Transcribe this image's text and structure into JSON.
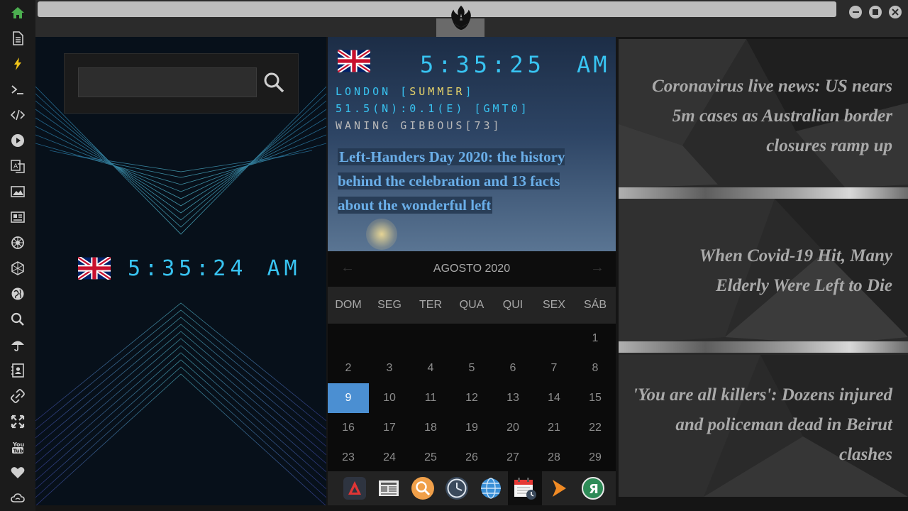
{
  "sidebar": {
    "items": [
      {
        "icon": "home-icon",
        "color": "#4caf50"
      },
      {
        "icon": "document-icon"
      },
      {
        "icon": "lightning-icon",
        "color": "#f0c419"
      },
      {
        "icon": "terminal-icon"
      },
      {
        "icon": "code-icon"
      },
      {
        "icon": "play-icon"
      },
      {
        "icon": "translate-icon"
      },
      {
        "icon": "image-icon"
      },
      {
        "icon": "news-icon"
      },
      {
        "icon": "jedi-order-icon"
      },
      {
        "icon": "galactic-empire-icon"
      },
      {
        "icon": "globe-icon"
      },
      {
        "icon": "search-icon"
      },
      {
        "icon": "umbrella-icon"
      },
      {
        "icon": "contacts-icon"
      },
      {
        "icon": "link-icon"
      },
      {
        "icon": "expand-icon"
      },
      {
        "icon": "youtube-icon"
      },
      {
        "icon": "heart-icon"
      },
      {
        "icon": "cloud-icon"
      }
    ]
  },
  "left_clock": {
    "time": "5:35:24",
    "ampm": "AM"
  },
  "search": {
    "value": "",
    "placeholder": ""
  },
  "world_clock": {
    "time": "5:35:25",
    "ampm": "AM",
    "city_prefix": "LONDON [",
    "city_season": "SUMMER",
    "city_suffix": "]",
    "coords": "51.5(N):0.1(E) [GMT0]",
    "moon": "WANING GIBBOUS[73]"
  },
  "feature_headline": "Left-Handers Day 2020: the history behind the celebration and 13 facts about the wonderful left",
  "calendar": {
    "month_label": "AGOSTO 2020",
    "prev": "←",
    "next": "→",
    "weekdays": [
      "DOM",
      "SEG",
      "TER",
      "QUA",
      "QUI",
      "SEX",
      "SÁB"
    ],
    "weeks": [
      [
        "",
        "",
        "",
        "",
        "",
        "",
        "1"
      ],
      [
        "2",
        "3",
        "4",
        "5",
        "6",
        "7",
        "8"
      ],
      [
        "9",
        "10",
        "11",
        "12",
        "13",
        "14",
        "15"
      ],
      [
        "16",
        "17",
        "18",
        "19",
        "20",
        "21",
        "22"
      ],
      [
        "23",
        "24",
        "25",
        "26",
        "27",
        "28",
        "29"
      ]
    ],
    "selected_day": "9"
  },
  "dock": {
    "items": [
      {
        "icon": "rebel-app-icon"
      },
      {
        "icon": "newspaper-app-icon"
      },
      {
        "icon": "search-app-icon"
      },
      {
        "icon": "clock-app-icon"
      },
      {
        "icon": "globe-app-icon"
      },
      {
        "icon": "calendar-app-icon",
        "active": true
      },
      {
        "icon": "play-app-icon"
      },
      {
        "icon": "yandex-app-icon"
      }
    ]
  },
  "news": {
    "items": [
      "Coronavirus live news: US nears 5m cases as Australian border closures ramp up",
      "When Covid-19 Hit, Many Elderly Were Left to Die",
      "'You are all killers': Dozens injured and policeman dead in Beirut clashes"
    ]
  },
  "colors": {
    "accent_cyan": "#38c4f2",
    "calendar_selected": "#4b8fd2",
    "season_yellow": "#e6d36a"
  }
}
